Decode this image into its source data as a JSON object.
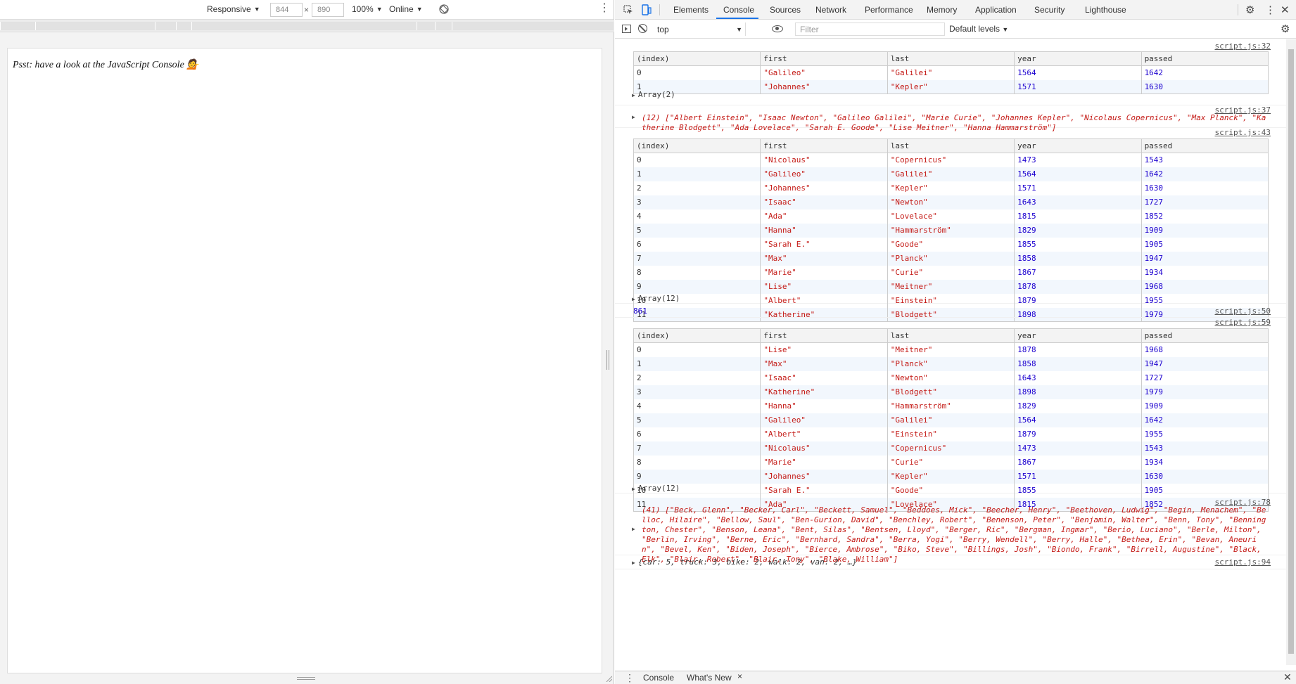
{
  "device_toolbar": {
    "device": "Responsive",
    "width": "844",
    "times": "×",
    "height": "890",
    "zoom": "100%",
    "network": "Online",
    "more": "⋮"
  },
  "page": {
    "text": "Psst: have a look at the JavaScript Console 💁"
  },
  "devtools": {
    "tabs": [
      "Elements",
      "Console",
      "Sources",
      "Network",
      "Performance",
      "Memory",
      "Application",
      "Security",
      "Lighthouse"
    ],
    "active_tab": "Console",
    "context": "top",
    "filter_placeholder": "Filter",
    "levels": "Default levels"
  },
  "console": {
    "entry1": {
      "source": "script.js:32",
      "headers": [
        "(index)",
        "first",
        "last",
        "year",
        "passed"
      ],
      "rows": [
        [
          "0",
          "\"Galileo\"",
          "\"Galilei\"",
          "1564",
          "1642"
        ],
        [
          "1",
          "\"Johannes\"",
          "\"Kepler\"",
          "1571",
          "1630"
        ]
      ],
      "array_label": "Array(2)"
    },
    "entry2": {
      "source": "script.js:37",
      "text": "(12) [\"Albert Einstein\", \"Isaac Newton\", \"Galileo Galilei\", \"Marie Curie\", \"Johannes Kepler\", \"Nicolaus Copernicus\", \"Max Planck\", \"Katherine Blodgett\", \"Ada Lovelace\", \"Sarah E. Goode\", \"Lise Meitner\", \"Hanna Hammarström\"]"
    },
    "entry3": {
      "source": "script.js:43",
      "headers": [
        "(index)",
        "first",
        "last",
        "year",
        "passed"
      ],
      "rows": [
        [
          "0",
          "\"Nicolaus\"",
          "\"Copernicus\"",
          "1473",
          "1543"
        ],
        [
          "1",
          "\"Galileo\"",
          "\"Galilei\"",
          "1564",
          "1642"
        ],
        [
          "2",
          "\"Johannes\"",
          "\"Kepler\"",
          "1571",
          "1630"
        ],
        [
          "3",
          "\"Isaac\"",
          "\"Newton\"",
          "1643",
          "1727"
        ],
        [
          "4",
          "\"Ada\"",
          "\"Lovelace\"",
          "1815",
          "1852"
        ],
        [
          "5",
          "\"Hanna\"",
          "\"Hammarström\"",
          "1829",
          "1909"
        ],
        [
          "6",
          "\"Sarah E.\"",
          "\"Goode\"",
          "1855",
          "1905"
        ],
        [
          "7",
          "\"Max\"",
          "\"Planck\"",
          "1858",
          "1947"
        ],
        [
          "8",
          "\"Marie\"",
          "\"Curie\"",
          "1867",
          "1934"
        ],
        [
          "9",
          "\"Lise\"",
          "\"Meitner\"",
          "1878",
          "1968"
        ],
        [
          "10",
          "\"Albert\"",
          "\"Einstein\"",
          "1879",
          "1955"
        ],
        [
          "11",
          "\"Katherine\"",
          "\"Blodgett\"",
          "1898",
          "1979"
        ]
      ],
      "array_label": "Array(12)"
    },
    "entry4": {
      "source": "script.js:50",
      "value": "861"
    },
    "entry5": {
      "source": "script.js:59",
      "headers": [
        "(index)",
        "first",
        "last",
        "year",
        "passed"
      ],
      "rows": [
        [
          "0",
          "\"Lise\"",
          "\"Meitner\"",
          "1878",
          "1968"
        ],
        [
          "1",
          "\"Max\"",
          "\"Planck\"",
          "1858",
          "1947"
        ],
        [
          "2",
          "\"Isaac\"",
          "\"Newton\"",
          "1643",
          "1727"
        ],
        [
          "3",
          "\"Katherine\"",
          "\"Blodgett\"",
          "1898",
          "1979"
        ],
        [
          "4",
          "\"Hanna\"",
          "\"Hammarström\"",
          "1829",
          "1909"
        ],
        [
          "5",
          "\"Galileo\"",
          "\"Galilei\"",
          "1564",
          "1642"
        ],
        [
          "6",
          "\"Albert\"",
          "\"Einstein\"",
          "1879",
          "1955"
        ],
        [
          "7",
          "\"Nicolaus\"",
          "\"Copernicus\"",
          "1473",
          "1543"
        ],
        [
          "8",
          "\"Marie\"",
          "\"Curie\"",
          "1867",
          "1934"
        ],
        [
          "9",
          "\"Johannes\"",
          "\"Kepler\"",
          "1571",
          "1630"
        ],
        [
          "10",
          "\"Sarah E.\"",
          "\"Goode\"",
          "1855",
          "1905"
        ],
        [
          "11",
          "\"Ada\"",
          "\"Lovelace\"",
          "1815",
          "1852"
        ]
      ],
      "array_label": "Array(12)"
    },
    "entry6": {
      "source": "script.js:78",
      "text": "(41) [\"Beck, Glenn\", \"Becker, Carl\", \"Beckett, Samuel\", \"Beddoes, Mick\", \"Beecher, Henry\", \"Beethoven, Ludwig\", \"Begin, Menachem\", \"Belloc, Hilaire\", \"Bellow, Saul\", \"Ben-Gurion, David\", \"Benchley, Robert\", \"Benenson, Peter\", \"Benjamin, Walter\", \"Benn, Tony\", \"Bennington, Chester\", \"Benson, Leana\", \"Bent, Silas\", \"Bentsen, Lloyd\", \"Berger, Ric\", \"Bergman, Ingmar\", \"Berio, Luciano\", \"Berle, Milton\", \"Berlin, Irving\", \"Berne, Eric\", \"Bernhard, Sandra\", \"Berra, Yogi\", \"Berry, Wendell\", \"Berry, Halle\", \"Bethea, Erin\", \"Bevan, Aneurin\", \"Bevel, Ken\", \"Biden, Joseph\", \"Bierce, Ambrose\", \"Biko, Steve\", \"Billings, Josh\", \"Biondo, Frank\", \"Birrell, Augustine\", \"Black, Elk\", \"Blair, Robert\", \"Blair, Tony\", \"Blake, William\"]"
    },
    "entry7": {
      "source": "script.js:94",
      "text": "{car: 5, truck: 3, bike: 2, walk: 2, van: 2, …}"
    }
  },
  "drawer": {
    "tabs": [
      "Console",
      "What's New"
    ],
    "close": "×"
  }
}
